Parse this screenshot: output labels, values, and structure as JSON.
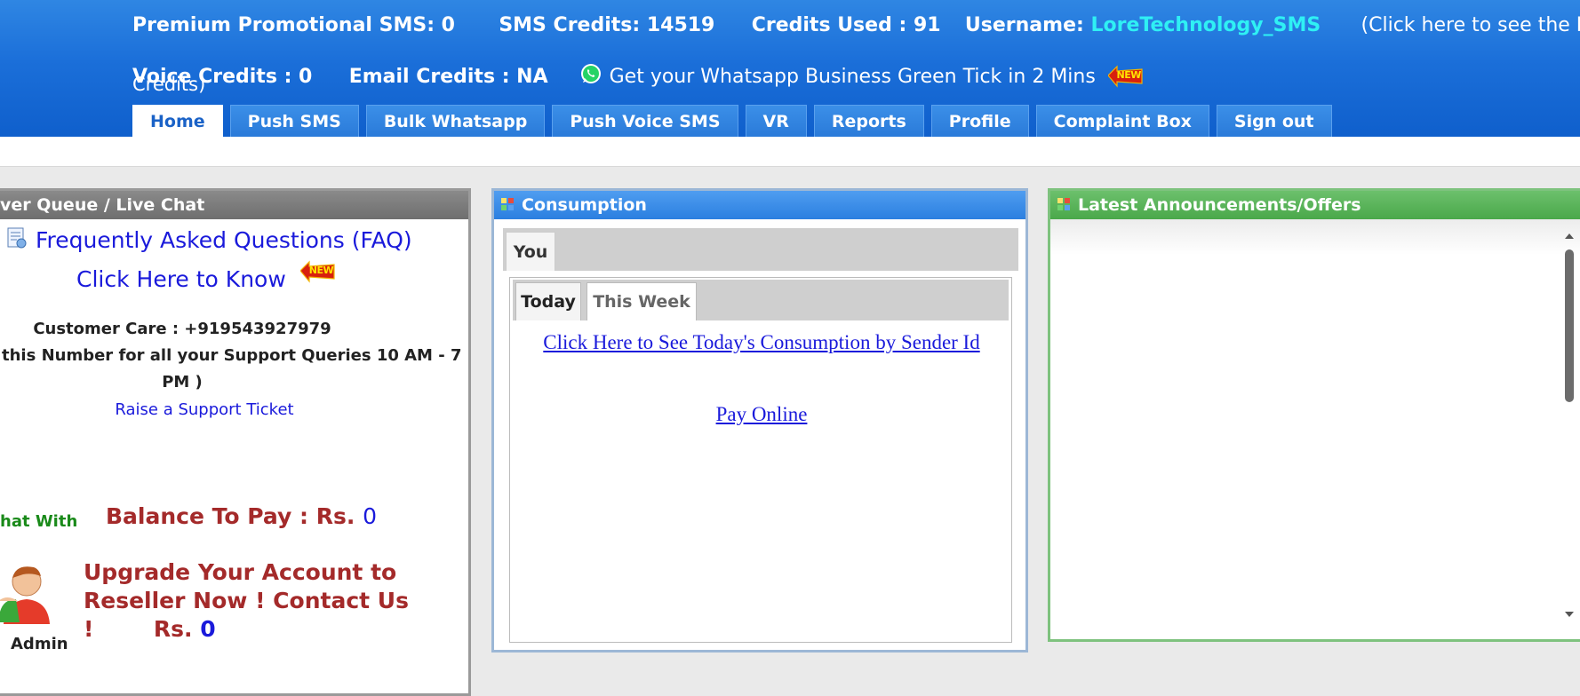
{
  "header": {
    "promo_label": "Premium Promotional SMS: 0",
    "sms_credits_label": "SMS Credits: 14519",
    "credits_used_label": "Credits Used : 91",
    "username_label": "Username:",
    "username_value": "LoreTechnology_SMS",
    "latest_link": "(Click here to see the Latest",
    "latest_link_tail": "Credits)",
    "voice_credits_label": "Voice Credits : 0",
    "email_credits_label": "Email Credits : NA",
    "whatsapp_promo": "Get your Whatsapp Business Green Tick in 2 Mins",
    "new_badge": "NEW"
  },
  "nav": {
    "tabs": [
      "Home",
      "Push SMS",
      "Bulk Whatsapp",
      "Push Voice SMS",
      "VR",
      "Reports",
      "Profile",
      "Complaint Box",
      "Sign out"
    ],
    "active": "Home"
  },
  "left_panel": {
    "title": "ver Queue / Live Chat",
    "faq_link": "Frequently Asked Questions (FAQ)",
    "know_link": "Click Here to Know",
    "new_badge": "NEW",
    "customer_care": "Customer Care : +919543927979",
    "support_line1": "this Number for all your Support Queries 10 AM - 7",
    "support_line2": "PM )",
    "support_ticket": "Raise a Support Ticket",
    "chat_with": "hat With",
    "balance_label": "Balance To Pay :  Rs.",
    "balance_value": "0",
    "upgrade_text": "Upgrade Your Account to Reseller Now ! Contact Us !",
    "upgrade_rs": "Rs.",
    "upgrade_value": "0",
    "admin_label": "Admin"
  },
  "mid_panel": {
    "title": "Consumption",
    "outer_tab": "You",
    "inner_tabs": [
      "Today",
      "This Week"
    ],
    "consumption_link": "Click Here to See Today's Consumption by Sender Id",
    "pay_online_link": "Pay Online"
  },
  "right_panel": {
    "title": "Latest Announcements/Offers"
  },
  "colors": {
    "header_blue": "#1b6fd9",
    "username_cyan": "#2ff0f4",
    "link_blue": "#1a1adb",
    "balance_red": "#a42a2a",
    "chat_green": "#1a8a1a",
    "consumption_head": "#2b7fe0",
    "announce_head": "#4aa84a"
  }
}
